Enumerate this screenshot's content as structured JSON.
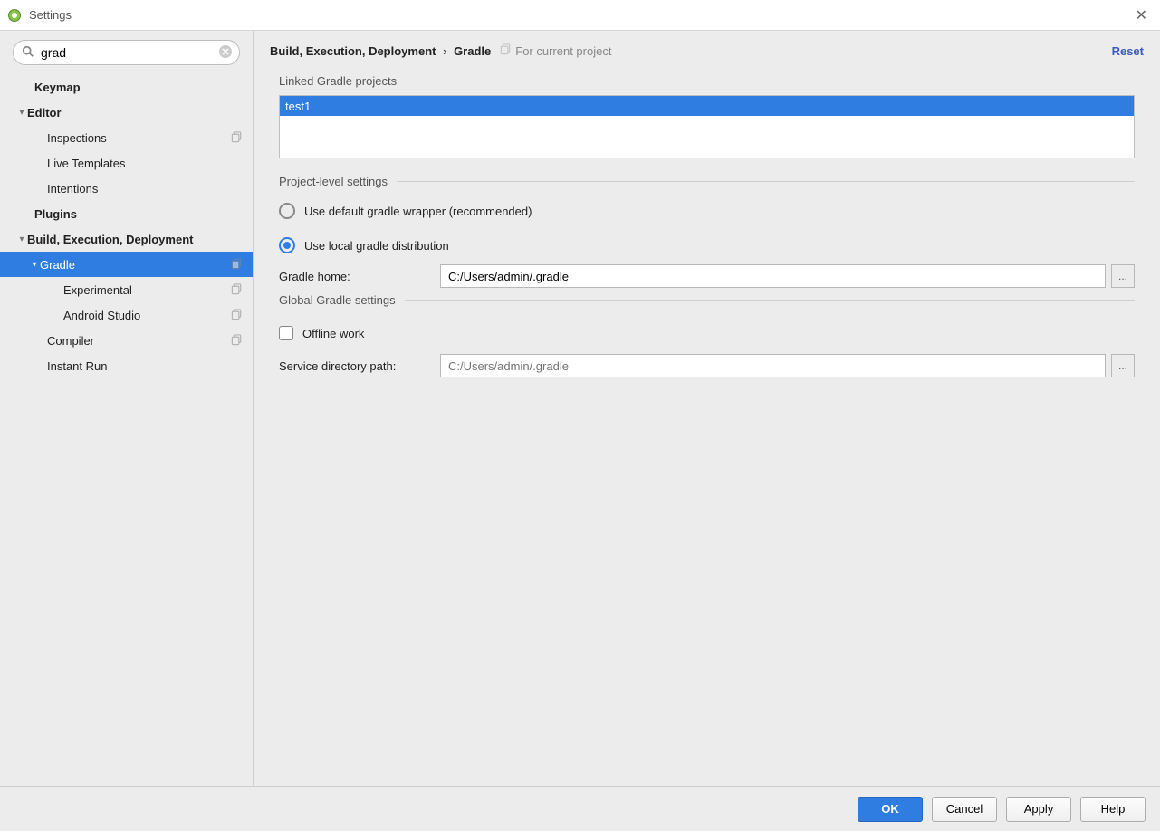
{
  "window": {
    "title": "Settings",
    "close_glyph": "✕"
  },
  "search": {
    "value": "grad"
  },
  "sidebar": {
    "items": [
      {
        "label": "Keymap",
        "bold": true,
        "indent": 0,
        "arrow": ""
      },
      {
        "label": "Editor",
        "bold": true,
        "indent": 0,
        "arrow": "▾"
      },
      {
        "label": "Inspections",
        "bold": false,
        "indent": 1,
        "arrow": "",
        "copy": true
      },
      {
        "label": "Live Templates",
        "bold": false,
        "indent": 1,
        "arrow": ""
      },
      {
        "label": "Intentions",
        "bold": false,
        "indent": 1,
        "arrow": ""
      },
      {
        "label": "Plugins",
        "bold": true,
        "indent": 0,
        "arrow": ""
      },
      {
        "label": "Build, Execution, Deployment",
        "bold": true,
        "indent": 0,
        "arrow": "▾"
      },
      {
        "label": "Gradle",
        "bold": false,
        "indent": 1,
        "arrow": "▾",
        "selected": true,
        "copy": true
      },
      {
        "label": "Experimental",
        "bold": false,
        "indent": 2,
        "arrow": "",
        "copy": true
      },
      {
        "label": "Android Studio",
        "bold": false,
        "indent": 2,
        "arrow": "",
        "copy": true
      },
      {
        "label": "Compiler",
        "bold": false,
        "indent": 1,
        "arrow": "",
        "copy": true
      },
      {
        "label": "Instant Run",
        "bold": false,
        "indent": 1,
        "arrow": ""
      }
    ]
  },
  "header": {
    "crumb1": "Build, Execution, Deployment",
    "sep": "›",
    "crumb2": "Gradle",
    "scope": "For current project",
    "reset": "Reset"
  },
  "sections": {
    "linked_projects": "Linked Gradle projects",
    "project_level": "Project-level settings",
    "global": "Global Gradle settings"
  },
  "projects": {
    "items": [
      {
        "name": "test1",
        "selected": true
      }
    ]
  },
  "radios": {
    "default_wrapper": "Use default gradle wrapper (recommended)",
    "local_dist": "Use local gradle distribution"
  },
  "fields": {
    "gradle_home_label": "Gradle home:",
    "gradle_home_value": "C:/Users/admin/.gradle",
    "service_dir_label": "Service directory path:",
    "service_dir_placeholder": "C:/Users/admin/.gradle",
    "browse_glyph": "..."
  },
  "checkbox": {
    "offline_work": "Offline work"
  },
  "footer": {
    "ok": "OK",
    "cancel": "Cancel",
    "apply": "Apply",
    "help": "Help"
  }
}
